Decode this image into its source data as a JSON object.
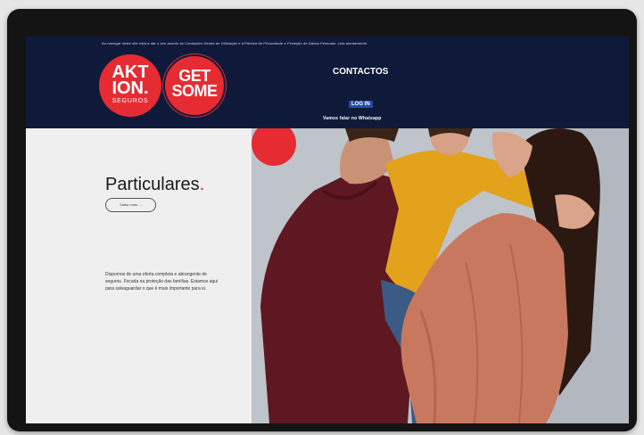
{
  "header": {
    "consent_text": "Ao navegar neste site está a dar o seu acordo às Condições Gerais de Utilização e à Política de Privacidade e Proteção de Dados Pessoais. Leia atentamente.",
    "logo_aktion": {
      "line1": "AKT",
      "line2": "ION.",
      "line3": "SEGUROS"
    },
    "logo_getsome": {
      "line1": "GET",
      "line2": "SOME"
    },
    "nav": {
      "contactos": "CONTACTOS",
      "login": "LOG IN",
      "whatsapp": "Vamos falar no Whatsapp"
    }
  },
  "main": {
    "title": "Particulares",
    "title_dot": ".",
    "more_button": "Saiba mais  →",
    "description": "Dispomos de uma oferta completa e abrangente de seguros. Focada na proteção das famílias. Estamos aqui para salvaguardar o que é mais importante para si."
  },
  "colors": {
    "brand_red": "#e62b33",
    "navy": "#0f1a3a"
  }
}
